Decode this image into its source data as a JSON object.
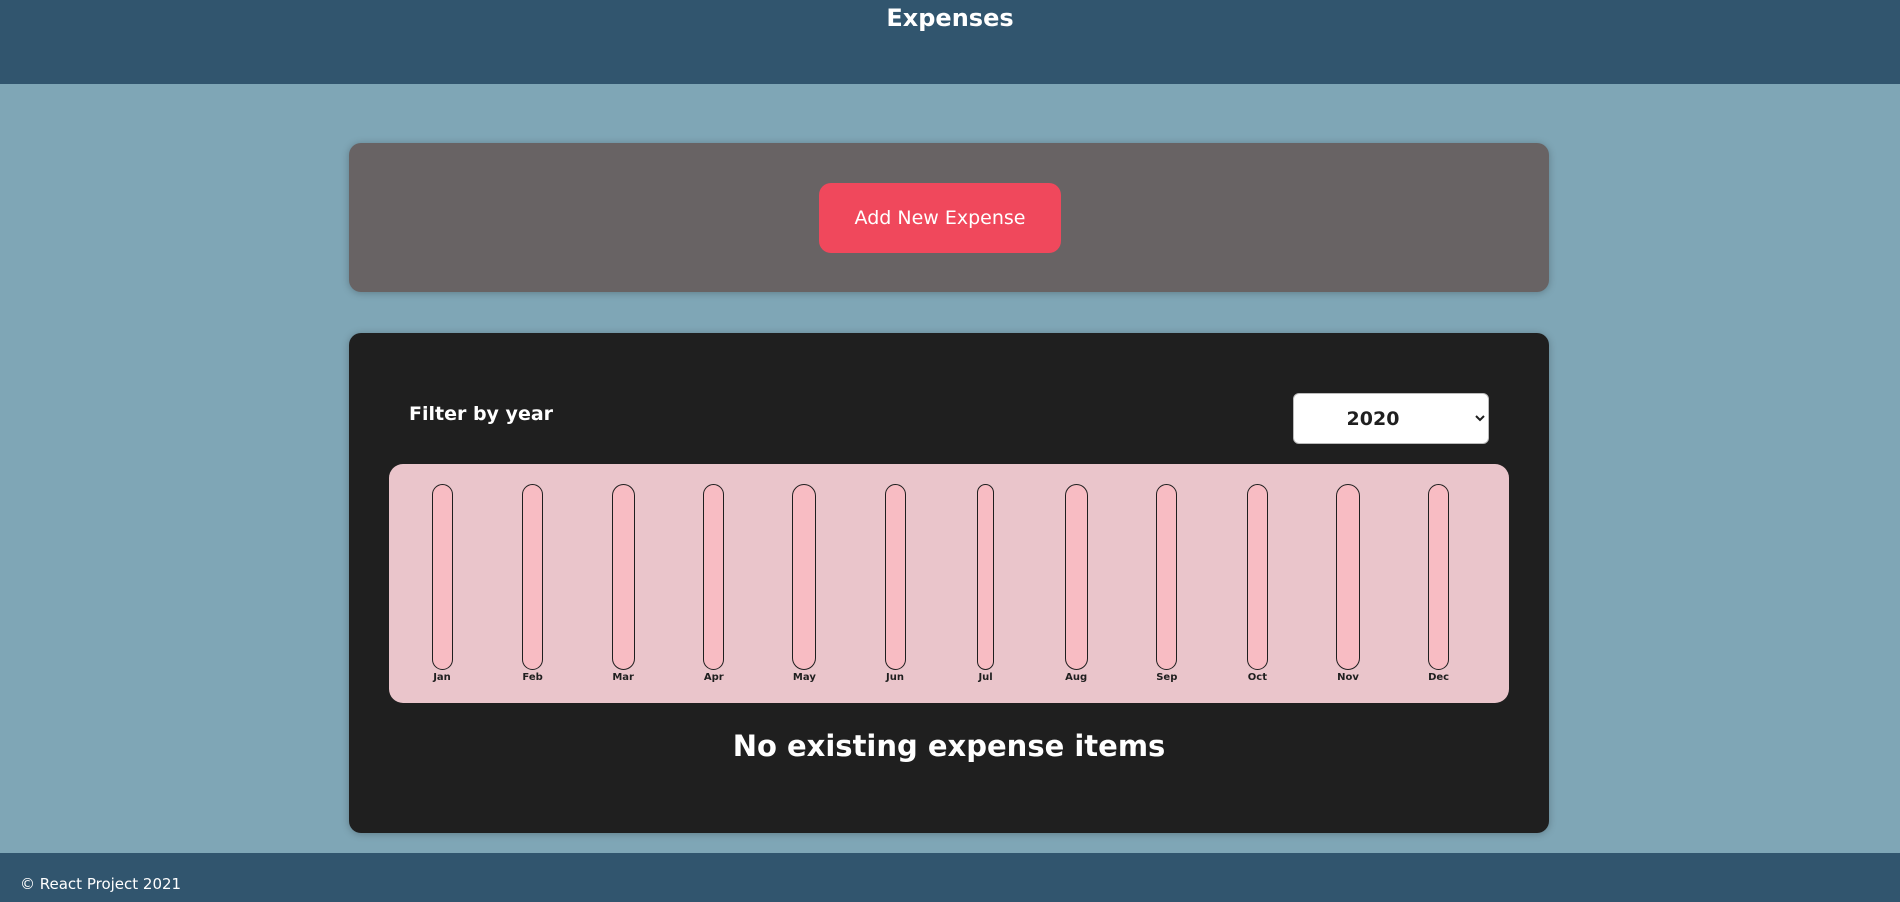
{
  "header": {
    "title": "Expenses"
  },
  "new_expense": {
    "button_label": "Add New Expense"
  },
  "filter": {
    "label": "Filter by year",
    "selected_year": "2020",
    "options": [
      "2020"
    ]
  },
  "chart_data": {
    "type": "bar",
    "categories": [
      "Jan",
      "Feb",
      "Mar",
      "Apr",
      "May",
      "Jun",
      "Jul",
      "Aug",
      "Sep",
      "Oct",
      "Nov",
      "Dec"
    ],
    "values": [
      0,
      0,
      0,
      0,
      0,
      0,
      0,
      0,
      0,
      0,
      0,
      0
    ],
    "title": "",
    "xlabel": "",
    "ylabel": ""
  },
  "expenses": {
    "empty_message": "No existing expense items"
  },
  "footer": {
    "text": "© React Project 2021"
  },
  "colors": {
    "header_bg": "#31556e",
    "page_bg": "#7fa6b6",
    "new_expense_bg": "#686364",
    "button_bg": "#f0485c",
    "expenses_bg": "#1f1f1f",
    "chart_bg": "#eac5cb",
    "bar_bg": "#f8bcc3"
  }
}
